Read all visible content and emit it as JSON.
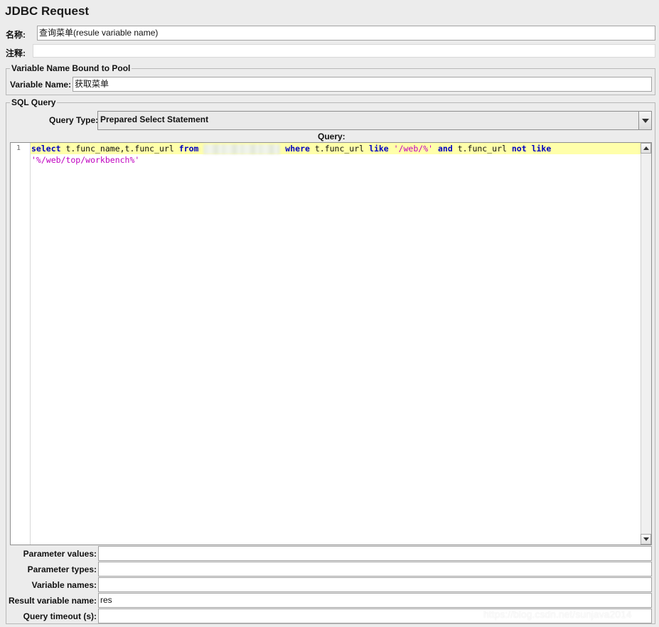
{
  "header": {
    "title": "JDBC Request"
  },
  "name_row": {
    "label": "名称:",
    "value": "查询菜单(resule variable name)"
  },
  "comment_row": {
    "label": "注释:",
    "value": ""
  },
  "pool_group": {
    "legend": "Variable Name Bound to Pool",
    "label": "Variable Name:",
    "value": "获取菜单"
  },
  "sql_group": {
    "legend": "SQL Query",
    "query_type_label": "Query Type:",
    "query_type_value": "Prepared Select Statement",
    "query_label": "Query:",
    "editor": {
      "line_number": "1",
      "tokens": {
        "t1": "select",
        "t2": " t.func_name,t.func_url ",
        "t3": "from",
        "t4": "where",
        "t5": " t.func_url ",
        "t6": "like",
        "t7": " ",
        "t8": "'/web/%'",
        "t9": " ",
        "t10": "and",
        "t11": " t.func_url ",
        "t12": "not",
        "t13": " ",
        "t14": "like",
        "t15": "'%/web/top/workbench%'"
      }
    }
  },
  "params": {
    "parameter_values": {
      "label": "Parameter values:",
      "value": ""
    },
    "parameter_types": {
      "label": "Parameter types:",
      "value": ""
    },
    "variable_names": {
      "label": "Variable names:",
      "value": ""
    },
    "result_variable_name": {
      "label": "Result variable name:",
      "value": "res"
    },
    "query_timeout": {
      "label": "Query timeout (s):",
      "value": ""
    }
  },
  "watermark": "https://blog.csdn.net/sunjava2014",
  "colors": {
    "background": "#ececec",
    "keyword": "#0000c0",
    "string": "#c000c0",
    "current_line": "#ffffaa"
  }
}
